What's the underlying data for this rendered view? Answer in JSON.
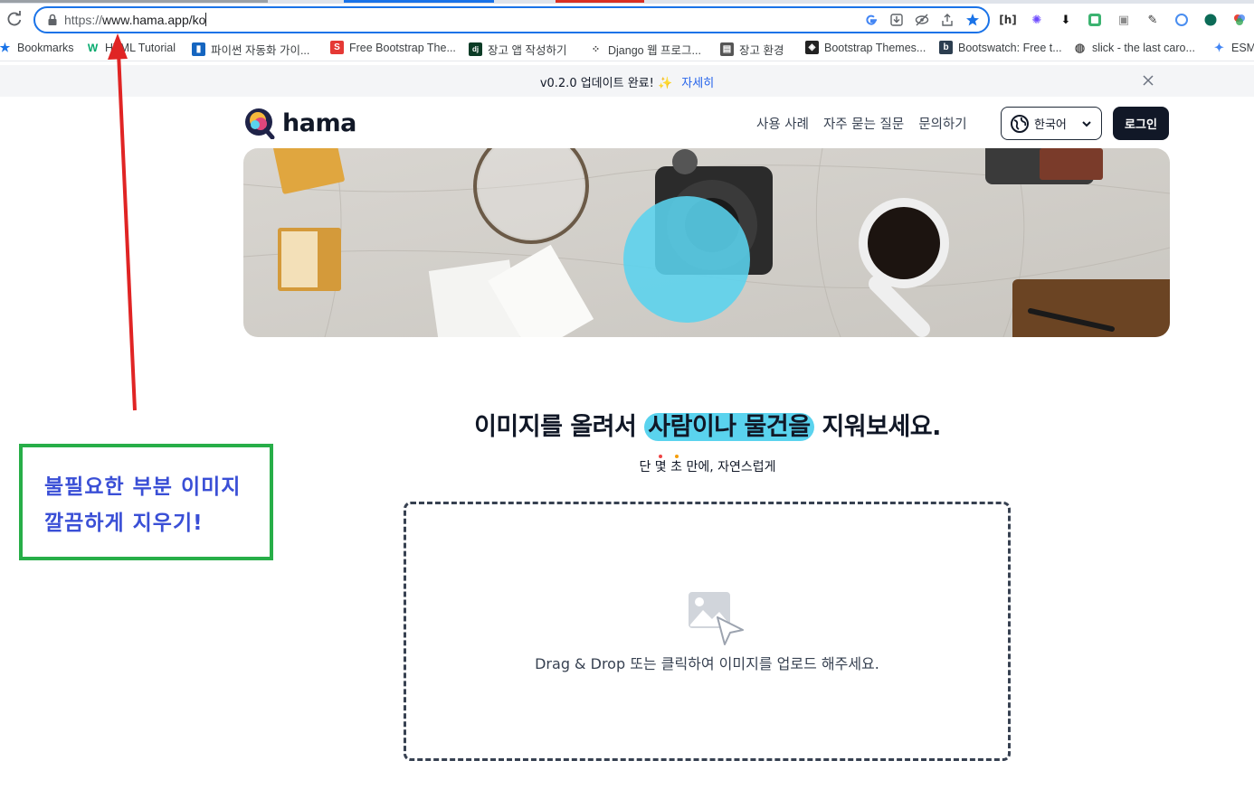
{
  "browser": {
    "url_scheme": "https://",
    "url_rest": "www.hama.app/ko",
    "bookmarks": [
      "Bookmarks",
      "HTML Tutorial",
      "파이썬 자동화 가이...",
      "Free Bootstrap The...",
      "장고 앱 작성하기",
      "Django 웹 프로그...",
      "장고 환경",
      "Bootstrap Themes...",
      "Bootswatch: Free t...",
      "slick - the last caro...",
      "ESM"
    ]
  },
  "banner": {
    "text": "v0.2.0 업데이트 완료!",
    "emoji": "✨",
    "link": "자세히"
  },
  "site": {
    "logo": "hama",
    "nav": [
      "사용 사례",
      "자주 묻는 질문",
      "문의하기"
    ],
    "language": "한국어",
    "login": "로그인"
  },
  "main": {
    "headline_pre": "이미지를 올려서 ",
    "headline_mark": "사람이나 물건을",
    "headline_post": " 지워보세요.",
    "sub_a": "단 ",
    "sub_b": "몇",
    "sub_c": " ",
    "sub_d": "초",
    "sub_e": " 만에, 자연스럽게",
    "dropzone_text": "Drag & Drop 또는 클릭하여 이미지를 업로드 해주세요."
  },
  "annotation": {
    "line1": "불필요한 부분 이미지",
    "line2": "깔끔하게 지우기!"
  },
  "colors": {
    "highlight": "#5ad3ee",
    "callout_border": "#27ae48",
    "callout_text": "#3a4fd6",
    "arrow": "#e02424",
    "omnibox_border": "#1a73e8"
  }
}
